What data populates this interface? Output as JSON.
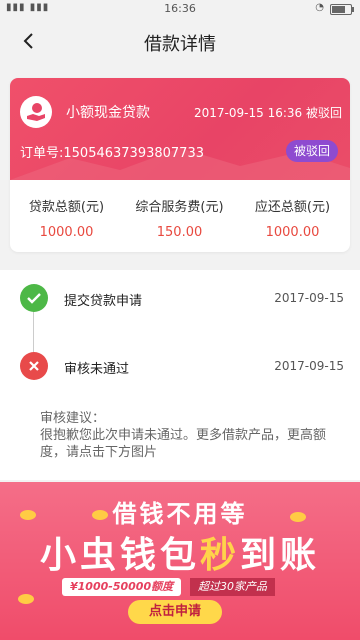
{
  "status_bar": {
    "time": "16:36"
  },
  "header": {
    "title": "借款详情"
  },
  "loan_card": {
    "product_name": "小额现金贷款",
    "datetime": "2017-09-15 16:36",
    "status_text": "被驳回",
    "order_label": "订单号:",
    "order_no": "15054637393807733",
    "status_badge": "被驳回",
    "stats": [
      {
        "label": "贷款总额(元)",
        "value": "1000.00"
      },
      {
        "label": "综合服务费(元)",
        "value": "150.00"
      },
      {
        "label": "应还总额(元)",
        "value": "1000.00"
      }
    ]
  },
  "timeline": [
    {
      "text": "提交贷款申请",
      "date": "2017-09-15"
    },
    {
      "text": "审核未通过",
      "date": "2017-09-15"
    }
  ],
  "advice": {
    "title": "审核建议：",
    "body": "很抱歉您此次申请未通过。更多借款产品，更高额度，请点击下方图片"
  },
  "banner": {
    "line1": "借钱不用等",
    "line2_a": "小虫钱包",
    "line2_hl": "秒",
    "line2_b": "到账",
    "amount": "¥1000-50000额度",
    "over": "超过30家产品",
    "cta": "点击申请"
  }
}
